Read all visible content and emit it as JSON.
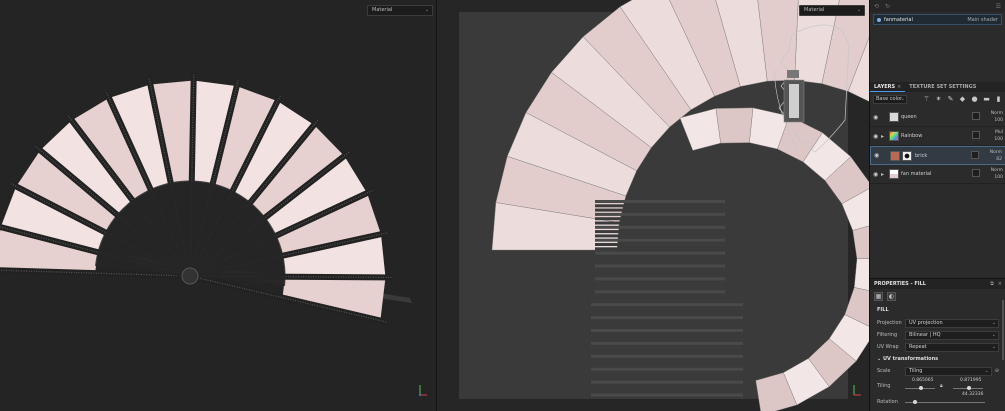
{
  "viewport3d": {
    "channel": "Material"
  },
  "viewport2d": {
    "channel": "Material"
  },
  "texture_set": {
    "name": "fanmaterial",
    "shader": "Main shader"
  },
  "tabs": [
    {
      "label": "LAYERS"
    },
    {
      "label": "TEXTURE SET SETTINGS"
    }
  ],
  "blend_mode": "Base color",
  "layers": [
    {
      "name": "queen",
      "blend": "Norm",
      "opacity": "100"
    },
    {
      "name": "Rainbow",
      "blend": "Mul",
      "opacity": "100"
    },
    {
      "name": "brick",
      "blend": "Norm",
      "opacity": "82"
    },
    {
      "name": "fan material",
      "blend": "Norm",
      "opacity": "100"
    }
  ],
  "properties": {
    "title": "PROPERTIES - FILL",
    "section": "FILL",
    "projection": {
      "label": "Projection",
      "value": "UV projection"
    },
    "filtering": {
      "label": "Filtering",
      "value": "Bilinear | HQ"
    },
    "uvwrap": {
      "label": "UV Wrap",
      "value": "Repeat"
    },
    "uv_transformations": "UV transformations",
    "scale": {
      "label": "Scale",
      "value": "Tiling"
    },
    "tiling": {
      "label": "Tiling",
      "u": "0.865065",
      "v": "0.871995"
    },
    "rotation": {
      "label": "Rotation",
      "value": "44.32336"
    }
  },
  "colors": {
    "accent": "#4a9be8",
    "fan_pink": "#eed9d9",
    "background": "#242424"
  }
}
